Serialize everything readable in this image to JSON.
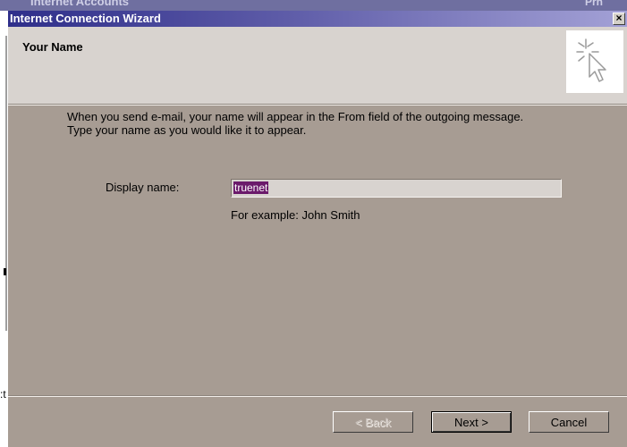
{
  "background": {
    "title": "Internet Accounts",
    "title_right": "Prn",
    "left_fragment": ":t"
  },
  "dialog": {
    "title": "Internet Connection Wizard",
    "close_label": "×",
    "header_title": "Your Name",
    "header_icon": "wizard-cursor-sparkle-icon",
    "intro_line1": "When you send e-mail, your name will appear in the From field of the outgoing message.",
    "intro_line2": "Type your name as you would like it to appear.",
    "display_name_label": "Display name:",
    "display_name_value": "truenet",
    "example_text": "For example: John Smith",
    "buttons": {
      "back": "< Back",
      "next": "Next >",
      "cancel": "Cancel"
    }
  },
  "colors": {
    "dialog_bg": "#a79c93",
    "header_bg": "#d8d3cf",
    "title_gradient_start": "#2e2e8a",
    "title_gradient_end": "#a3a1d6",
    "selection_bg": "#6b1a6b"
  }
}
